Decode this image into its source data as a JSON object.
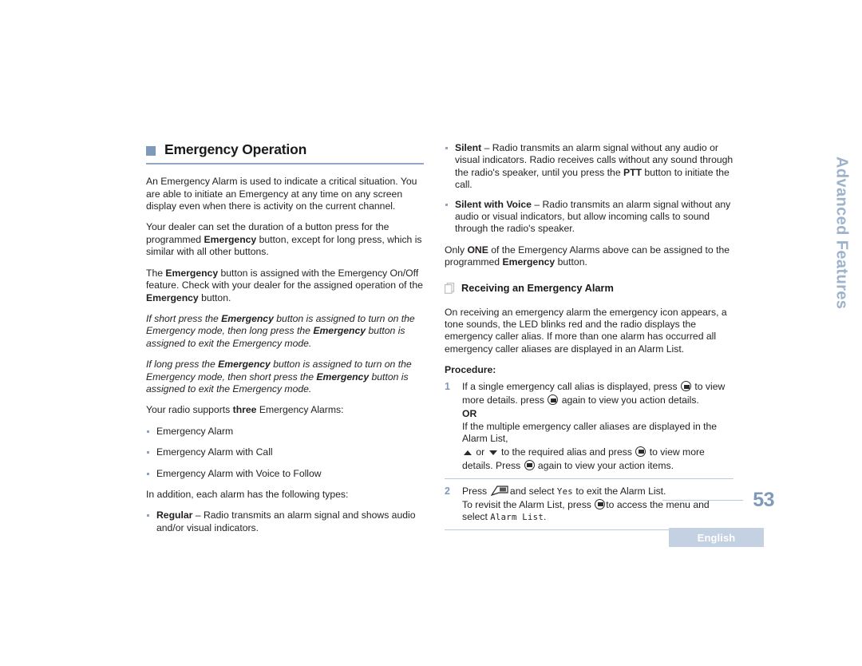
{
  "page": {
    "number": "53",
    "language_badge": "English",
    "side_tab": "Advanced Features"
  },
  "left_column": {
    "chapter_title": "Emergency Operation",
    "paragraphs": [
      "An Emergency Alarm is used to indicate a critical situation. You are able to initiate an Emergency at any time on any screen display even when there is activity on the current channel.",
      "Your dealer can set the duration of a button press for the programmed Emergency button, except for long press, which is similar with all other buttons.",
      "The Emergency button is assigned with the Emergency On/Off feature. Check with your dealer for the assigned operation of the Emergency button.",
      "If short press the Emergency button is assigned to turn on the Emergency mode, then long press the Emergency button is assigned to exit the Emergency mode.",
      "If long press the Emergency button is assigned to turn on the Emergency mode, then short press the Emergency button is assigned to exit the Emergency mode.",
      "Your radio supports three Emergency Alarms:"
    ],
    "alarm_types": [
      "Emergency Alarm",
      "Emergency Alarm with Call",
      "Emergency Alarm with Voice to Follow"
    ],
    "addition_intro": "In addition, each alarm has the following types:",
    "regular_bullet": {
      "term": "Regular",
      "dash": "–",
      "text": "Radio transmits an alarm signal and shows audio and/or visual indicators."
    }
  },
  "right_column": {
    "silent_bullet": {
      "term": "Silent",
      "dash": "–",
      "text_part1": "Radio transmits an alarm signal without any audio or visual indicators. Radio receives calls without any sound through the radio's speaker, until you press the ",
      "ptt": "PTT",
      "text_part2": " button to initiate the call."
    },
    "silent_voice_bullet": {
      "term": "Silent with Voice",
      "dash": "–",
      "text": "Radio transmits an alarm signal without any audio or visual indicators, but allow incoming calls to sound through the radio's speaker."
    },
    "only_one_paragraph": {
      "part1": "Only ",
      "one": "ONE",
      "part2": " of the Emergency Alarms above can be assigned to the programmed ",
      "emergency": "Emergency",
      "part3": " button."
    },
    "sub_heading": "Receiving an Emergency Alarm",
    "intro_paragraph": "On receiving an emergency alarm the emergency icon appears, a tone sounds, the LED blinks red and the radio displays the emergency caller alias. If more than one alarm has occurred all emergency caller aliases are displayed in an Alarm List.",
    "procedure_label": "Procedure:",
    "steps": [
      {
        "number": "1",
        "line1_a": "If a single emergency call alias is displayed, press ",
        "line1_b": " to view more details. press ",
        "line1_c": " again to view you action details.",
        "or": "OR",
        "line2_a": "If the multiple emergency caller aliases are displayed in the Alarm List, ",
        "line2_b": " or ",
        "line2_c": " to the required alias and press ",
        "line2_d": " to view more details. Press ",
        "line2_e": " again to view your action items."
      },
      {
        "number": "2",
        "line1_a": "Press ",
        "line1_b": " and select ",
        "yes": "Yes",
        "line1_c": " to exit the Alarm List.",
        "line2_a": "To revisit the Alarm List, press ",
        "line2_b": "to access the menu and select ",
        "alarm_list": "Alarm List",
        "line2_c": "."
      }
    ]
  },
  "colors": {
    "accent_blue": "#7e9abb",
    "rule_blue": "#b9cbdd",
    "badge_blue": "#c3d1e2",
    "text": "#231f20"
  }
}
